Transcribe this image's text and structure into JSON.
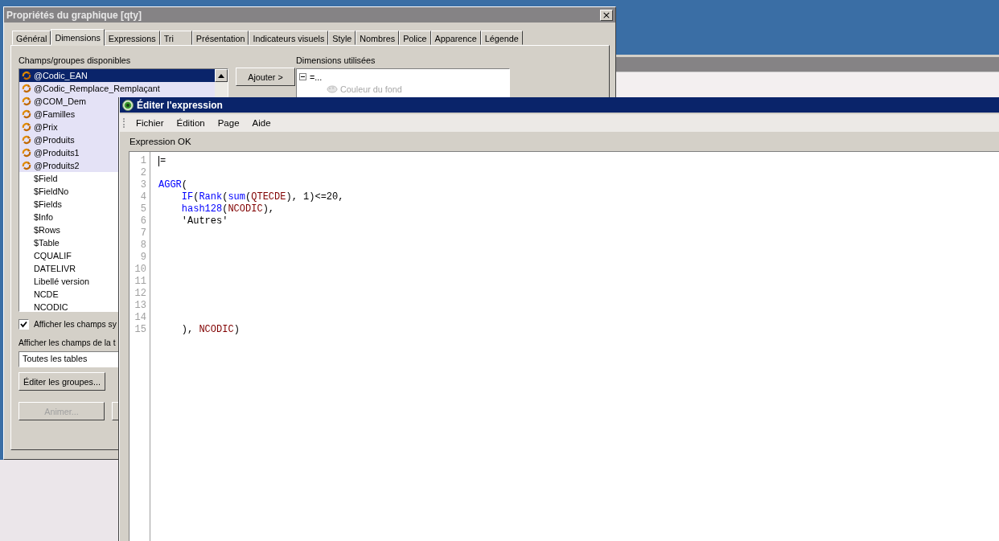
{
  "properties_dialog": {
    "title": "Propriétés du graphique [qty]",
    "close_button": "×",
    "tabs": [
      {
        "label": "Général",
        "selected": false
      },
      {
        "label": "Dimensions",
        "selected": true
      },
      {
        "label": "Expressions",
        "selected": false
      },
      {
        "label": "Tri",
        "selected": false
      },
      {
        "label": "Présentation",
        "selected": false
      },
      {
        "label": "Indicateurs visuels",
        "selected": false
      },
      {
        "label": "Style",
        "selected": false
      },
      {
        "label": "Nombres",
        "selected": false
      },
      {
        "label": "Police",
        "selected": false
      },
      {
        "label": "Apparence",
        "selected": false
      },
      {
        "label": "Légende",
        "selected": false
      }
    ],
    "available_label": "Champs/groupes disponibles",
    "available_fields": [
      {
        "label": "@Codic_EAN",
        "kind": "group",
        "selected": true
      },
      {
        "label": "@Codic_Remplace_Remplaçant",
        "kind": "group",
        "selected": false
      },
      {
        "label": "@COM_Dem",
        "kind": "group",
        "selected": false
      },
      {
        "label": "@Familles",
        "kind": "group",
        "selected": false
      },
      {
        "label": "@Prix",
        "kind": "group",
        "selected": false
      },
      {
        "label": "@Produits",
        "kind": "group",
        "selected": false
      },
      {
        "label": "@Produits1",
        "kind": "group",
        "selected": false
      },
      {
        "label": "@Produits2",
        "kind": "group",
        "selected": false
      },
      {
        "label": "$Field",
        "kind": "field",
        "selected": false
      },
      {
        "label": "$FieldNo",
        "kind": "field",
        "selected": false
      },
      {
        "label": "$Fields",
        "kind": "field",
        "selected": false
      },
      {
        "label": "$Info",
        "kind": "field",
        "selected": false
      },
      {
        "label": "$Rows",
        "kind": "field",
        "selected": false
      },
      {
        "label": "$Table",
        "kind": "field",
        "selected": false
      },
      {
        "label": "CQUALIF",
        "kind": "field",
        "selected": false
      },
      {
        "label": "DATELIVR",
        "kind": "field",
        "selected": false
      },
      {
        "label": "Libellé version",
        "kind": "field",
        "selected": false
      },
      {
        "label": "NCDE",
        "kind": "field",
        "selected": false
      },
      {
        "label": "NCODIC",
        "kind": "field",
        "selected": false
      }
    ],
    "show_system_fields": {
      "label": "Afficher les champs sy",
      "checked": true
    },
    "table_filter_label": "Afficher les champs de la t",
    "table_filter": {
      "value": "Toutes les tables"
    },
    "edit_groups_button": "Éditer les groupes...",
    "animate_button": {
      "label": "Animer...",
      "disabled": true
    },
    "add_button": "Ajouter >",
    "used_label": "Dimensions utilisées",
    "used_dimensions": [
      {
        "label": "=...",
        "expanded": true,
        "children": [
          {
            "label": "Couleur du fond",
            "disabled": true
          }
        ]
      }
    ]
  },
  "expression_editor": {
    "title": "Éditer l'expression",
    "menu": [
      "Fichier",
      "Édition",
      "Page",
      "Aide"
    ],
    "status": "Expression OK",
    "lines": [
      {
        "number": "1",
        "indented": false,
        "tokens": [
          {
            "text": "=",
            "kind": "plain"
          }
        ]
      },
      {
        "number": "2"
      },
      {
        "number": "3",
        "indented": false,
        "tokens": [
          {
            "text": "AGGR",
            "kind": "function"
          },
          {
            "text": "(",
            "kind": "plain"
          }
        ]
      },
      {
        "number": "4",
        "indented": true,
        "tokens": [
          {
            "text": "IF",
            "kind": "function"
          },
          {
            "text": "(",
            "kind": "plain"
          },
          {
            "text": "Rank",
            "kind": "function"
          },
          {
            "text": "(",
            "kind": "plain"
          },
          {
            "text": "sum",
            "kind": "function"
          },
          {
            "text": "(",
            "kind": "plain"
          },
          {
            "text": "QTECDE",
            "kind": "field"
          },
          {
            "text": "), 1)<=20,",
            "kind": "plain"
          }
        ]
      },
      {
        "number": "5",
        "indented": true,
        "tokens": [
          {
            "text": "hash128",
            "kind": "function"
          },
          {
            "text": "(",
            "kind": "plain"
          },
          {
            "text": "NCODIC",
            "kind": "field"
          },
          {
            "text": "),",
            "kind": "plain"
          }
        ]
      },
      {
        "number": "6",
        "indented": true,
        "tokens": [
          {
            "text": "'Autres'",
            "kind": "plain"
          }
        ]
      },
      {
        "number": "7"
      },
      {
        "number": "8"
      },
      {
        "number": "9"
      },
      {
        "number": "10"
      },
      {
        "number": "11"
      },
      {
        "number": "12"
      },
      {
        "number": "13"
      },
      {
        "number": "14"
      },
      {
        "number": "15",
        "indented": true,
        "tokens": [
          {
            "text": "), ",
            "kind": "plain"
          },
          {
            "text": "NCODIC",
            "kind": "field"
          },
          {
            "text": ")",
            "kind": "plain"
          }
        ]
      }
    ]
  }
}
